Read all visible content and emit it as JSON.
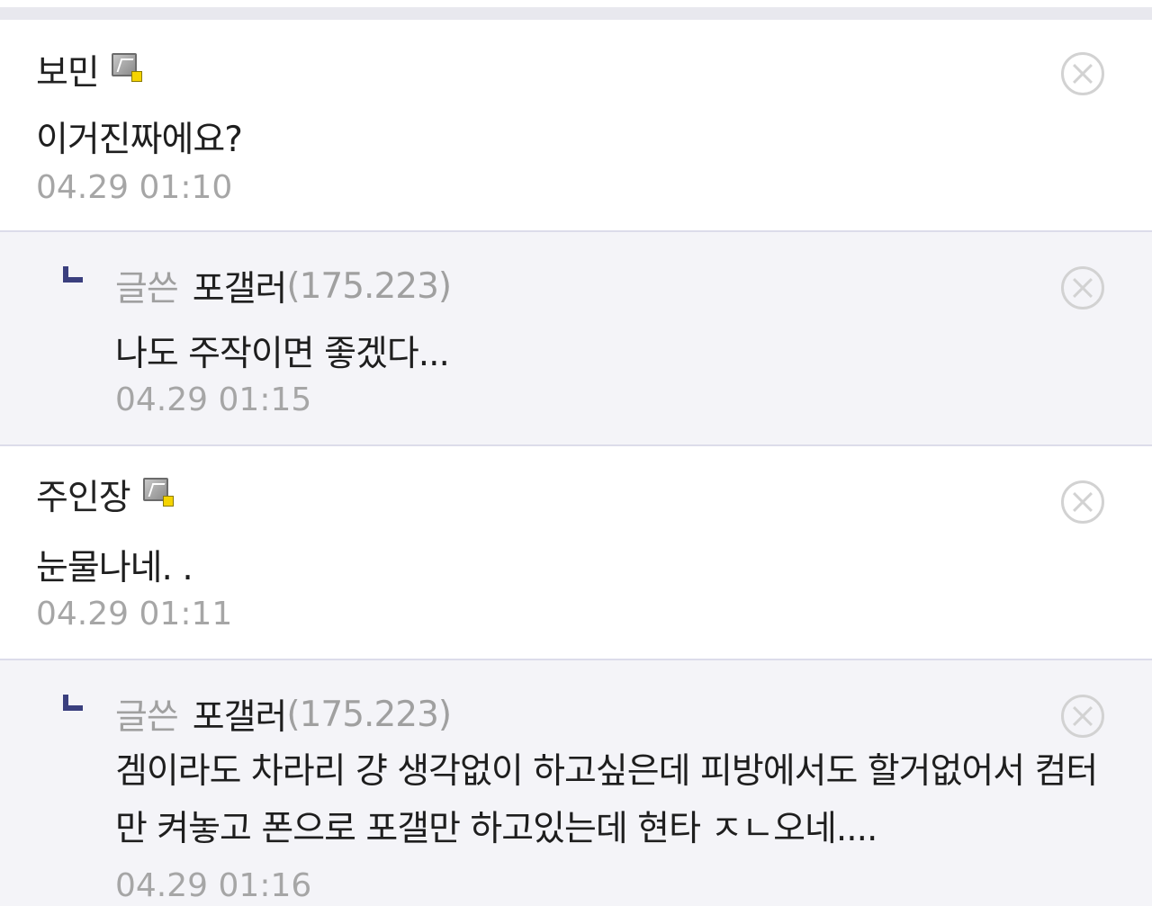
{
  "comments": [
    {
      "nickname": "보민",
      "text": "이거진짜에요?",
      "time": "04.29 01:10",
      "icon": "fixed-member-icon",
      "reply": {
        "writer_label": "글쓴",
        "nickname": "포갤러",
        "ip": "(175.223)",
        "text": "나도 주작이면 좋겠다...",
        "time": "04.29 01:15"
      }
    },
    {
      "nickname": "주인장",
      "text": "눈물나네. .",
      "time": "04.29 01:11",
      "icon": "fixed-member-icon",
      "reply": {
        "writer_label": "글쓴",
        "nickname": "포갤러",
        "ip": "(175.223)",
        "text": "겜이라도 차라리 걍 생각없이 하고싶은데 피방에서도 할거없어서 컴터만 켜놓고 폰으로 포갤만 하고있는데 현타 ㅈㄴ오네....",
        "time": "04.29 01:16"
      }
    }
  ],
  "icons": {
    "delete": "close-circle-icon",
    "reply": "reply-arrow-icon"
  },
  "colors": {
    "reply_background": "#f4f4f8",
    "divider": "#dcdcea",
    "timestamp": "#a6a6a6",
    "reply_arrow": "#3a3f7e"
  }
}
